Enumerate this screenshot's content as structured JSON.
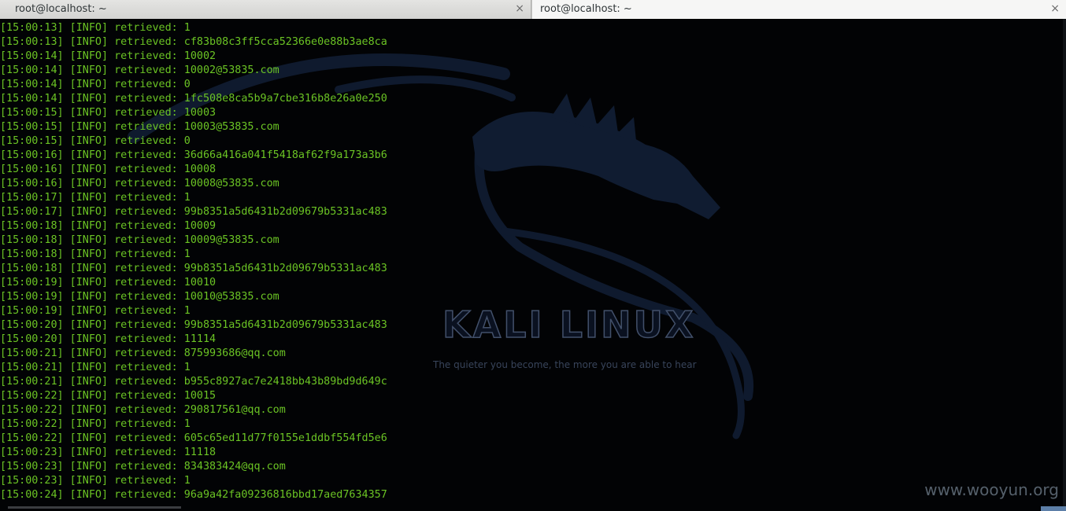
{
  "tabs": [
    {
      "title": "root@localhost: ~",
      "close": "×",
      "active": false
    },
    {
      "title": "root@localhost: ~",
      "close": "×",
      "active": true
    }
  ],
  "wallpaper": {
    "logo_text": "KALI LINUX",
    "tagline": "The quieter you become, the more you are able to hear",
    "watermark": "www.wooyun.org"
  },
  "colors": {
    "terminal_bg": "#020305",
    "log_text": "#6bc424",
    "tab_active_bg": "#f6f6f5"
  },
  "log_lines": [
    "[15:00:13] [INFO] retrieved: 1",
    "[15:00:13] [INFO] retrieved: cf83b08c3ff5cca52366e0e88b3ae8ca",
    "[15:00:14] [INFO] retrieved: 10002",
    "[15:00:14] [INFO] retrieved: 10002@53835.com",
    "[15:00:14] [INFO] retrieved: 0",
    "[15:00:14] [INFO] retrieved: 1fc508e8ca5b9a7cbe316b8e26a0e250",
    "[15:00:15] [INFO] retrieved: 10003",
    "[15:00:15] [INFO] retrieved: 10003@53835.com",
    "[15:00:15] [INFO] retrieved: 0",
    "[15:00:16] [INFO] retrieved: 36d66a416a041f5418af62f9a173a3b6",
    "[15:00:16] [INFO] retrieved: 10008",
    "[15:00:16] [INFO] retrieved: 10008@53835.com",
    "[15:00:17] [INFO] retrieved: 1",
    "[15:00:17] [INFO] retrieved: 99b8351a5d6431b2d09679b5331ac483",
    "[15:00:18] [INFO] retrieved: 10009",
    "[15:00:18] [INFO] retrieved: 10009@53835.com",
    "[15:00:18] [INFO] retrieved: 1",
    "[15:00:18] [INFO] retrieved: 99b8351a5d6431b2d09679b5331ac483",
    "[15:00:19] [INFO] retrieved: 10010",
    "[15:00:19] [INFO] retrieved: 10010@53835.com",
    "[15:00:19] [INFO] retrieved: 1",
    "[15:00:20] [INFO] retrieved: 99b8351a5d6431b2d09679b5331ac483",
    "[15:00:20] [INFO] retrieved: 11114",
    "[15:00:21] [INFO] retrieved: 875993686@qq.com",
    "[15:00:21] [INFO] retrieved: 1",
    "[15:00:21] [INFO] retrieved: b955c8927ac7e2418bb43b89bd9d649c",
    "[15:00:22] [INFO] retrieved: 10015",
    "[15:00:22] [INFO] retrieved: 290817561@qq.com",
    "[15:00:22] [INFO] retrieved: 1",
    "[15:00:22] [INFO] retrieved: 605c65ed11d77f0155e1ddbf554fd5e6",
    "[15:00:23] [INFO] retrieved: 11118",
    "[15:00:23] [INFO] retrieved: 834383424@qq.com",
    "[15:00:23] [INFO] retrieved: 1",
    "[15:00:24] [INFO] retrieved: 96a9a42fa09236816bbd17aed7634357"
  ]
}
